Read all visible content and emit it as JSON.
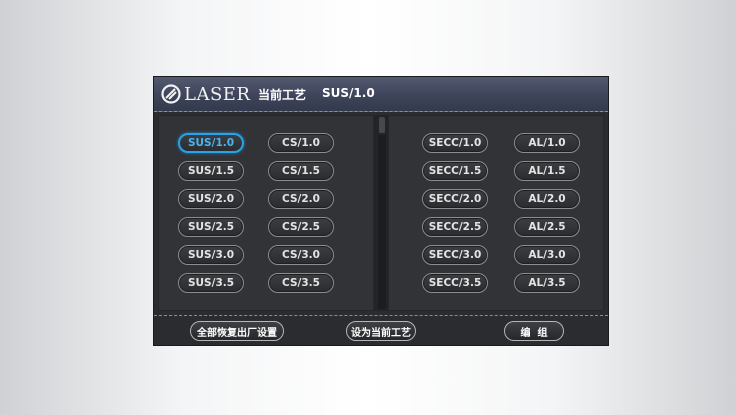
{
  "header": {
    "logo_text": "LASER",
    "title": "当前工艺",
    "current_process": "SUS/1.0"
  },
  "left_panel": {
    "column1": [
      "SUS/1.0",
      "SUS/1.5",
      "SUS/2.0",
      "SUS/2.5",
      "SUS/3.0",
      "SUS/3.5"
    ],
    "column2": [
      "CS/1.0",
      "CS/1.5",
      "CS/2.0",
      "CS/2.5",
      "CS/3.0",
      "CS/3.5"
    ]
  },
  "right_panel": {
    "column1": [
      "SECC/1.0",
      "SECC/1.5",
      "SECC/2.0",
      "SECC/2.5",
      "SECC/3.0",
      "SECC/3.5"
    ],
    "column2": [
      "AL/1.0",
      "AL/1.5",
      "AL/2.0",
      "AL/2.5",
      "AL/3.0",
      "AL/3.5"
    ]
  },
  "selected": "SUS/1.0",
  "footer": {
    "restore_label": "全部恢复出厂设置",
    "set_current_label": "设为当前工艺",
    "edit_label": "编  组"
  },
  "colors": {
    "accent": "#29a3e6",
    "title_bar": "#3e4459",
    "panel_bg": "#323336"
  }
}
